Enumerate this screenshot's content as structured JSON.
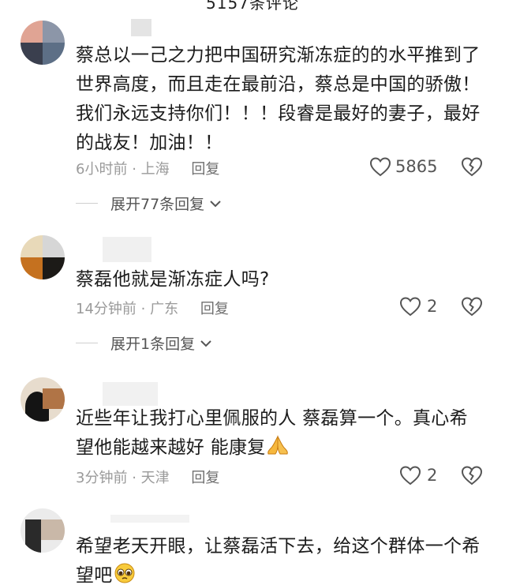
{
  "header": {
    "comment_count": "5157条评论"
  },
  "comments": [
    {
      "text": "蔡总以一己之力把中国研究渐冻症的的水平推到了世界高度，而且走在最前沿，蔡总是中国的骄傲！我们永远支持你们！！！段睿是最好的妻子，最好的战友！加油！！",
      "time": "6小时前",
      "location": "上海",
      "reply_label": "回复",
      "likes": "5865",
      "expand_label": "展开77条回复"
    },
    {
      "text": "蔡磊他就是渐冻症人吗?",
      "time": "14分钟前",
      "location": "广东",
      "reply_label": "回复",
      "likes": "2",
      "expand_label": "展开1条回复"
    },
    {
      "text": "近些年让我打心里佩服的人 蔡磊算一个。真心希望他能越来越好 能康复",
      "time": "3分钟前",
      "location": "天津",
      "reply_label": "回复",
      "likes": "2"
    },
    {
      "text": "希望老天开眼，让蔡磊活下去，给这个群体一个希望吧"
    }
  ],
  "icons": {
    "like": "heart-outline-icon",
    "dislike": "broken-heart-icon",
    "expand": "chevron-down-icon",
    "pray": "folded-hands-emoji",
    "pleading": "pleading-face-emoji"
  },
  "colors": {
    "meta": "#9a9a9a",
    "text": "#1c1c1c",
    "reply": "#6e6e6e"
  }
}
